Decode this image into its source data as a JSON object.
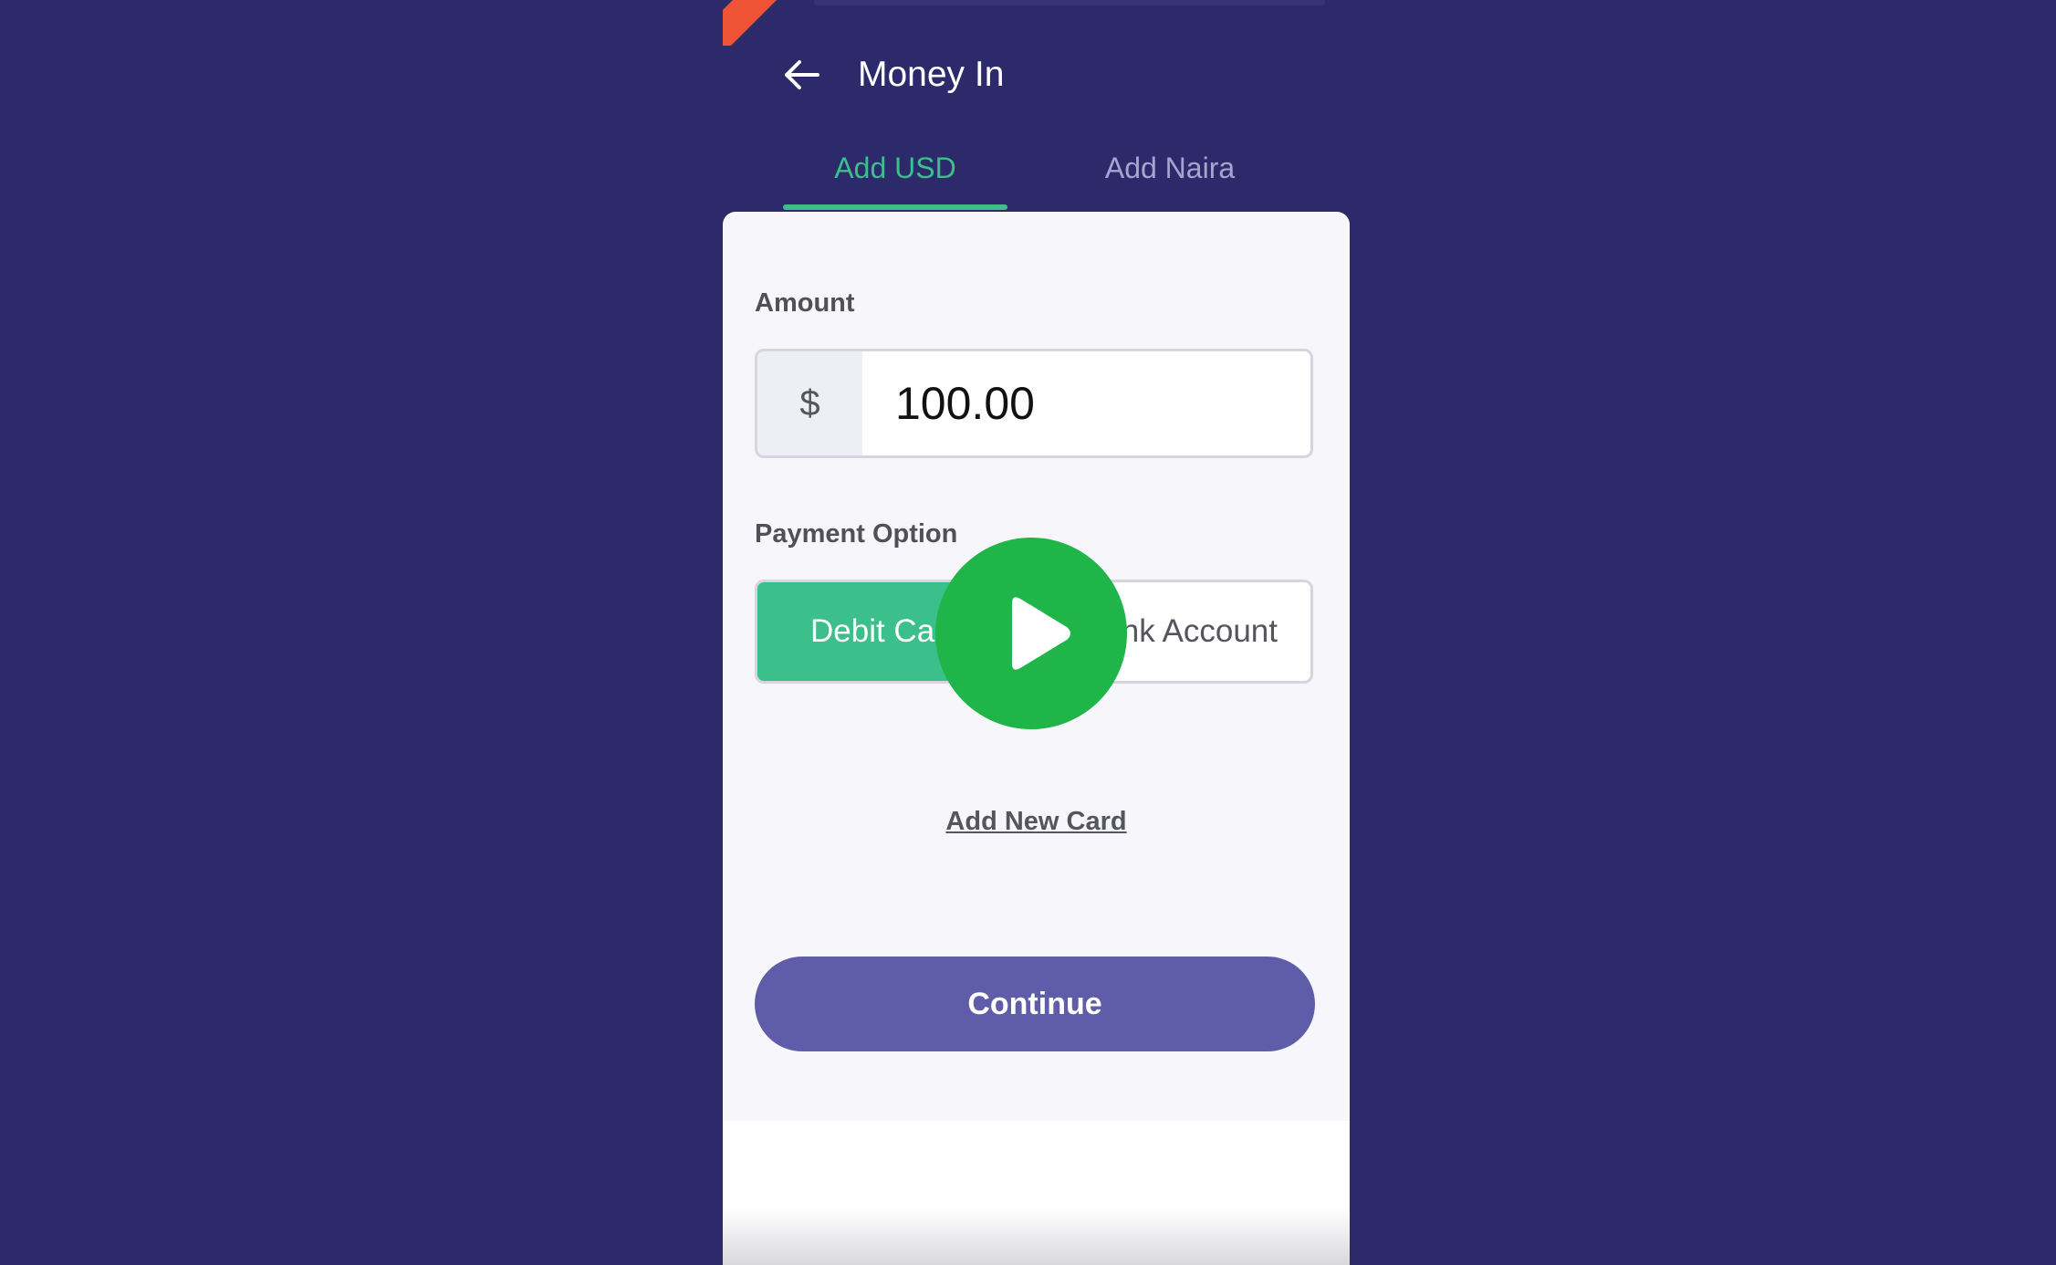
{
  "header": {
    "title": "Money In",
    "back_icon": "arrow-left-icon"
  },
  "tabs": [
    {
      "label": "Add USD",
      "active": true
    },
    {
      "label": "Add Naira",
      "active": false
    }
  ],
  "form": {
    "amount_label": "Amount",
    "currency_symbol": "$",
    "amount_value": "100.00",
    "payment_label": "Payment Option",
    "payment_options": [
      {
        "label": "Debit Card",
        "selected": true
      },
      {
        "label": "Bank Account",
        "selected": false
      }
    ],
    "add_card_label": "Add New Card",
    "continue_label": "Continue"
  },
  "overlay": {
    "play_icon": "play-icon"
  },
  "colors": {
    "background": "#2c2a6a",
    "accent_green": "#3bbf8b",
    "button_purple": "#5f5caa",
    "play_green": "#1fb548",
    "ribbon": "#ef5436"
  }
}
